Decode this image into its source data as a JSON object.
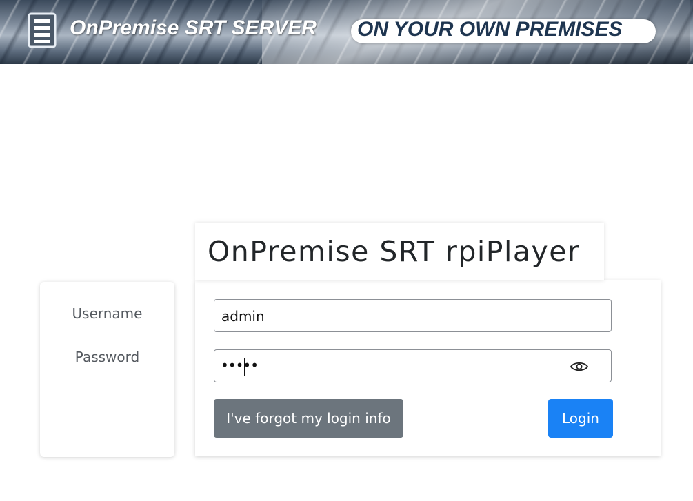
{
  "banner": {
    "title": "OnPremise SRT SERVER",
    "tagline": "ON YOUR OWN PREMISES",
    "logo_icon": "document-stack-icon"
  },
  "login": {
    "heading": "OnPremise SRT rpiPlayer",
    "username_label": "Username",
    "password_label": "Password",
    "username_value": "admin",
    "password_masked": "•••••",
    "toggle_icon": "eye-icon",
    "forgot_label": "I've forgot my login info",
    "login_label": "Login"
  },
  "colors": {
    "primary": "#1a82f5",
    "secondary": "#6c757d",
    "heading": "#222629"
  }
}
